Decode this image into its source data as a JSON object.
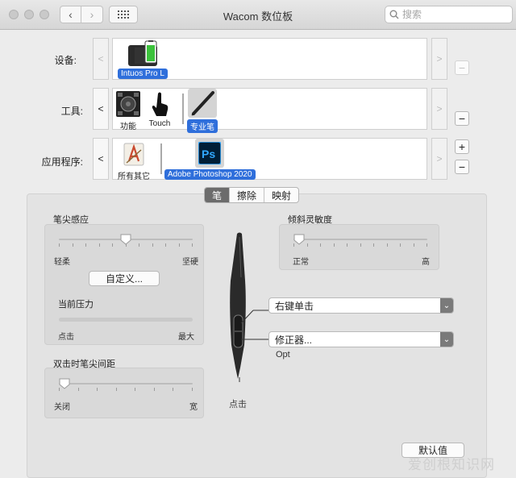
{
  "window": {
    "title": "Wacom 数位板",
    "search_placeholder": "搜索"
  },
  "rows": {
    "devices": {
      "label": "设备:",
      "items": [
        {
          "label": "Intuos Pro L",
          "selected": true
        }
      ]
    },
    "tools": {
      "label": "工具:",
      "items": [
        {
          "label": "功能",
          "selected": false
        },
        {
          "label": "Touch",
          "selected": false
        },
        {
          "label": "专业笔",
          "selected": true
        }
      ]
    },
    "apps": {
      "label": "应用程序:",
      "items": [
        {
          "label": "所有其它",
          "selected": false
        },
        {
          "label": "Adobe Photoshop 2020",
          "selected": true
        }
      ]
    },
    "arrow_left": "<",
    "arrow_right": ">"
  },
  "controls": {
    "minus": "−",
    "plus": "+"
  },
  "tabs": [
    {
      "label": "笔",
      "active": true
    },
    {
      "label": "擦除",
      "active": false
    },
    {
      "label": "映射",
      "active": false
    }
  ],
  "tip_feel": {
    "title": "笔尖感应",
    "min_label": "轻柔",
    "max_label": "坚硬",
    "value": 0.5,
    "customize_button": "自定义...",
    "current_pressure_label": "当前压力",
    "pressure_value": 0,
    "pressure_min": "点击",
    "pressure_max": "最大"
  },
  "double_click": {
    "title": "双击时笔尖间距",
    "min_label": "关闭",
    "max_label": "宽",
    "value": 0
  },
  "tilt": {
    "title": "倾斜灵敏度",
    "min_label": "正常",
    "max_label": "高",
    "value": 0
  },
  "pen": {
    "upper_button": "右键单击",
    "lower_button": "修正器...",
    "lower_sublabel": "Opt",
    "tip_label": "点击"
  },
  "default_button": "默认值",
  "watermark": "爱创根知识网",
  "colors": {
    "selection": "#2f6fdb",
    "tab_active": "#6c6c6c"
  }
}
